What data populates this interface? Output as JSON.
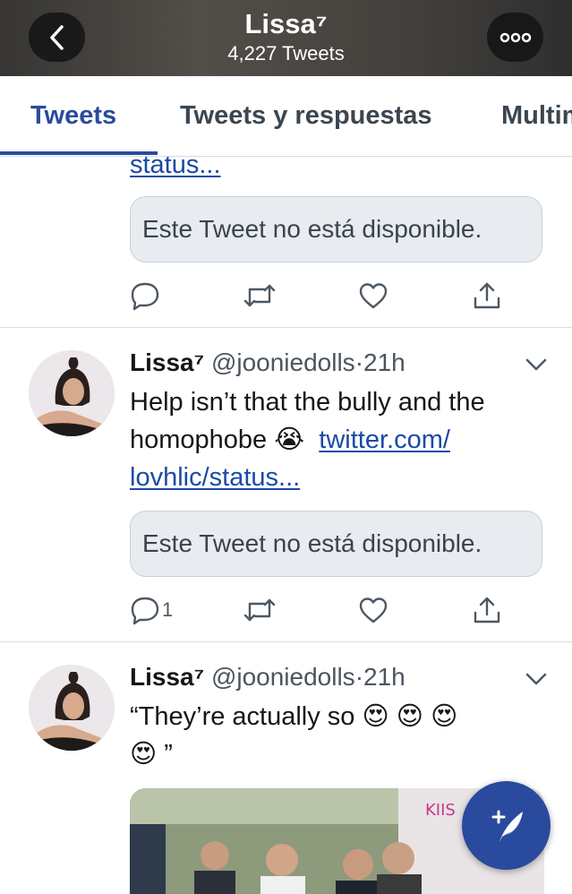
{
  "header": {
    "title": "Lissa⁷",
    "subtitle": "4,227 Tweets"
  },
  "tabs": [
    {
      "label": "Tweets",
      "active": true
    },
    {
      "label": "Tweets y respuestas",
      "active": false
    },
    {
      "label": "Multimedia",
      "active": false
    }
  ],
  "tweets": [
    {
      "partial_link": "status...",
      "quoted_tweet": "Este Tweet no está disponible.",
      "reply_count": "",
      "icons": [
        "reply-icon",
        "retweet-icon",
        "like-icon",
        "share-icon"
      ]
    },
    {
      "name": "Lissa⁷",
      "handle": "@jooniedolls",
      "time": "21h",
      "text_line1": "Help isn’t that the bully and the",
      "text_line2": "homophobe 😭",
      "link_part1": "twitter.com/",
      "link_part2": "lovhlic/status...",
      "quoted_tweet": "Este Tweet no está disponible.",
      "reply_count": "1"
    },
    {
      "name": "Lissa⁷",
      "handle": "@jooniedolls",
      "time": "21h",
      "text_line1": "“They’re actually so 😍 😍 😍",
      "text_line2": "😍 ”"
    }
  ],
  "colors": {
    "accent": "#2a4a9e",
    "link": "#1b4aa6",
    "quote_bg": "#e8ecf0"
  },
  "fab": {
    "icon": "compose-tweet-icon"
  }
}
